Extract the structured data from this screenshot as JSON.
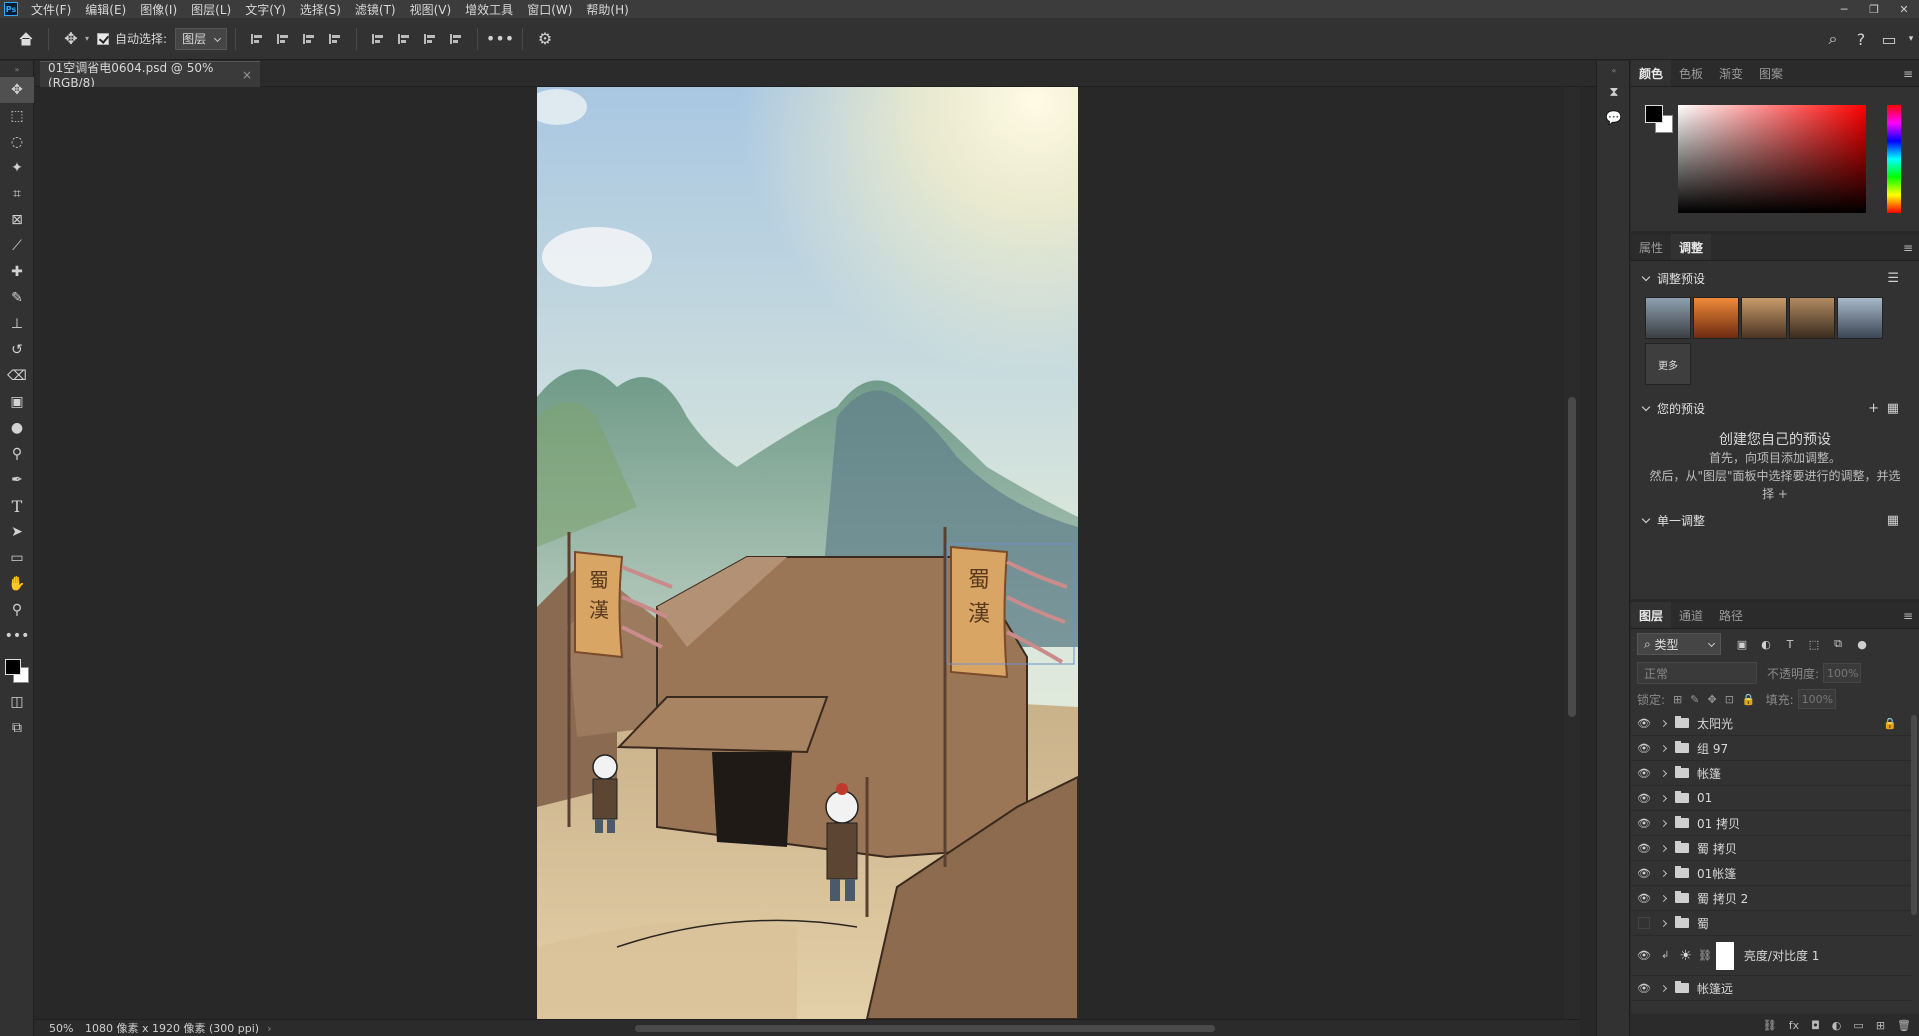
{
  "menu": [
    "文件(F)",
    "编辑(E)",
    "图像(I)",
    "图层(L)",
    "文字(Y)",
    "选择(S)",
    "滤镜(T)",
    "视图(V)",
    "增效工具",
    "窗口(W)",
    "帮助(H)"
  ],
  "options": {
    "auto_select_label": "自动选择:",
    "auto_select_target": "图层"
  },
  "document": {
    "tab_title": "01空调省电0604.psd @ 50%(RGB/8)",
    "close_glyph": "×"
  },
  "status": {
    "zoom": "50%",
    "info": "1080 像素 x 1920 像素 (300 ppi)"
  },
  "artwork": {
    "banner_text_1": "蜀",
    "banner_text_2": "漢"
  },
  "color_panel": {
    "tabs": [
      "颜色",
      "色板",
      "渐变",
      "图案"
    ],
    "foreground": "#000000",
    "background": "#ffffff"
  },
  "adjustments_panel": {
    "tabs": [
      "属性",
      "调整"
    ],
    "presets_title": "调整预设",
    "more_label": "更多",
    "your_presets_title": "您的预设",
    "create_title": "创建您自己的预设",
    "create_line1": "首先，向项目添加调整。",
    "create_line2": "然后，从\"图层\"面板中选择要进行的调整，并选择 +",
    "single_adjust_title": "单一调整"
  },
  "layers_panel": {
    "tabs": [
      "图层",
      "通道",
      "路径"
    ],
    "filter_kind": "类型",
    "blend_mode": "正常",
    "opacity_label": "不透明度:",
    "opacity_value": "100%",
    "lock_label": "锁定:",
    "fill_label": "填充:",
    "fill_value": "100%",
    "layers": [
      {
        "name": "太阳光",
        "visible": true,
        "locked": true
      },
      {
        "name": "组 97",
        "visible": true
      },
      {
        "name": "帐篷",
        "visible": true
      },
      {
        "name": "01",
        "visible": true
      },
      {
        "name": "01 拷贝",
        "visible": true
      },
      {
        "name": "蜀 拷贝",
        "visible": true
      },
      {
        "name": "01帐篷",
        "visible": true
      },
      {
        "name": "蜀 拷贝 2",
        "visible": true
      },
      {
        "name": "蜀",
        "visible": false
      },
      {
        "name": "亮度/对比度 1",
        "visible": true,
        "type": "adjustment"
      },
      {
        "name": "帐篷远",
        "visible": true
      }
    ]
  }
}
